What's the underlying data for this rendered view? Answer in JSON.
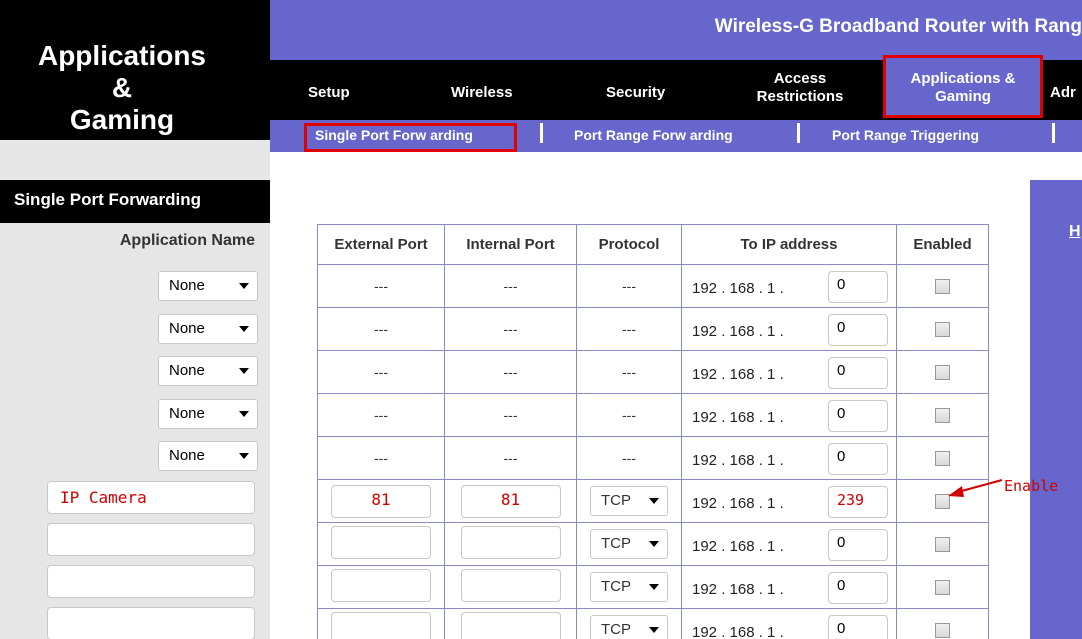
{
  "page": {
    "title_line1": "Applications &",
    "title_line2": "Gaming",
    "product_name": "Wireless-G Broadband Router with Rang"
  },
  "nav": {
    "setup": "Setup",
    "wireless": "Wireless",
    "security": "Security",
    "access_line1": "Access",
    "access_line2": "Restrictions",
    "apps_line1": "Applications &",
    "apps_line2": "Gaming",
    "admin": "Adr"
  },
  "subnav": {
    "single": "Single Port Forw arding",
    "range": "Port Range Forw arding",
    "triggering": "Port Range Triggering"
  },
  "left": {
    "section_title": "Single Port Forwarding",
    "app_name_header": "Application Name",
    "preset_value": "None",
    "custom_apps": [
      "IP Camera",
      "",
      "",
      ""
    ]
  },
  "table": {
    "headers": [
      "External Port",
      "Internal Port",
      "Protocol",
      "To IP address",
      "Enabled"
    ],
    "dash": "---",
    "ip_prefix": "192 . 168 . 1 .",
    "preset_rows_last_octet": [
      "0",
      "0",
      "0",
      "0",
      "0"
    ],
    "custom_rows": [
      {
        "external": "81",
        "internal": "81",
        "protocol": "TCP",
        "last_octet": "239",
        "enabled": true
      },
      {
        "external": "",
        "internal": "",
        "protocol": "TCP",
        "last_octet": "0",
        "enabled": false
      },
      {
        "external": "",
        "internal": "",
        "protocol": "TCP",
        "last_octet": "0",
        "enabled": false
      },
      {
        "external": "",
        "internal": "",
        "protocol": "TCP",
        "last_octet": "0",
        "enabled": false
      }
    ]
  },
  "annotation": {
    "enable_note": "Enable"
  },
  "help": {
    "link": "H"
  },
  "colors": {
    "brand_purple": "#6666cc",
    "highlight_red": "#e00000",
    "annotation_red": "#d00000"
  }
}
